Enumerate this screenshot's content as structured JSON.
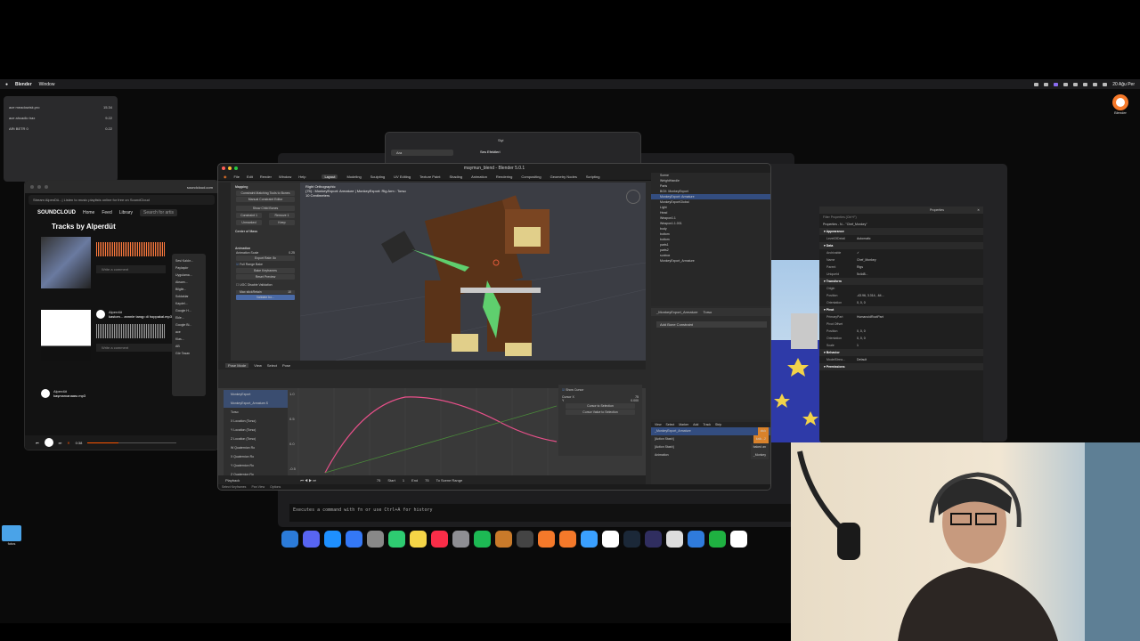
{
  "menubar": {
    "app": "Blender",
    "items": [
      "Window"
    ],
    "clock": "20 Ağu Per"
  },
  "small_panel": {
    "rows": [
      {
        "label": "ace meadowisk.pro",
        "value": "15.34"
      },
      {
        "label": "ace ahcadlo trax",
        "value": "9.22"
      },
      {
        "label": "ARt BETR 0",
        "value": "0.22"
      }
    ]
  },
  "soundcloud": {
    "domain": "soundcloud.com",
    "url": "Stream AlpenDü...| Listen to music playlists online for free on SoundCloud",
    "logo": "SOUNDCLOUD",
    "nav": [
      "Home",
      "Feed",
      "Library"
    ],
    "search_placeholder": "Search for artis",
    "page_title": "Tracks by Alperdüt",
    "tracks": [
      {
        "artist": "Alperdüt",
        "title": "kastom... annnle tanqp di hoppakal.mp3",
        "comment": "Write a comment"
      },
      {
        "artist": "Alperdüt",
        "title": "kaşmanıanaası.mp3",
        "comment": "Write a comment"
      }
    ],
    "time": "0:38",
    "context_menu": [
      "Sesi Kaldır...",
      "Paylaşılır",
      "Uygulama...",
      "Aksam...",
      "Bilgile...",
      "Soldaklar",
      "Kaydel...",
      "Google H...",
      "Ekle...",
      "Google Bi...",
      "ace",
      "Klas...",
      "AB",
      "Gör Tasarı"
    ],
    "context_progress": 0.35
  },
  "bg_window1": {
    "title": "Siyi",
    "search": "Ara",
    "item": "Ses Efektleri"
  },
  "blender": {
    "title": "maymun_blend - Blender 5.0.1",
    "menu": [
      "File",
      "Edit",
      "Render",
      "Window",
      "Help"
    ],
    "workspaces": [
      "Layout",
      "Modeling",
      "Sculpting",
      "UV Editing",
      "Texture Paint",
      "Shading",
      "Animation",
      "Rendering",
      "Compositing",
      "Geometry Nodes",
      "Scripting"
    ],
    "active_workspace": "Layout",
    "viewport_info": [
      "Right Orthographic",
      "(75) : MonkeyExport: Armature | MonkeyExport: Rig Arm : Torso",
      "10 Centimeters"
    ],
    "left_panel": {
      "section_a": "Mapping",
      "buttons": [
        "Constraint Matching Tools to Bones",
        "Manual Constraint Editor",
        "Show Child Bones",
        "Constraint 1",
        "Remove 1",
        "Unmarked",
        "Keep"
      ],
      "section_b": "Center of Mass",
      "section_c": "Animation",
      "field_scale": "Animation Scale",
      "field_scale_value": "0.25",
      "export_rate": "Export Rate: 8x",
      "checkbox_range": "Full Range Bake",
      "btn_bake": "Bake Keyframes",
      "btn_reset": "Reset Preview",
      "section_d": "UGC Disable Validation",
      "max_label": "Max stickRetain",
      "max_value": "10",
      "btn_validate": "Validate bo..."
    },
    "outliner": [
      {
        "label": "Scene",
        "sel": false
      },
      {
        "label": "WeightHandle",
        "sel": false
      },
      {
        "label": "Parts",
        "sel": false
      },
      {
        "label": "BOX: MonkeyExport",
        "sel": false
      },
      {
        "label": "MonkeyExport: Armature",
        "sel": true
      },
      {
        "label": "MonkeyExportGlobal",
        "sel": false
      },
      {
        "label": "Light",
        "sel": false
      },
      {
        "label": "Head",
        "sel": false
      },
      {
        "label": "Weapon1.1",
        "sel": false
      },
      {
        "label": "Weapon1.1.001",
        "sel": false
      },
      {
        "label": "body",
        "sel": false
      },
      {
        "label": "bottom",
        "sel": false
      },
      {
        "label": "bottom",
        "sel": false
      },
      {
        "label": "parts1",
        "sel": false
      },
      {
        "label": "parts2",
        "sel": false
      },
      {
        "label": "sunbox",
        "sel": false
      },
      {
        "label": "MonkeyExport_Armature",
        "sel": false
      }
    ],
    "properties": {
      "object": "_MonkeyExport_Armature",
      "tab": "Torso",
      "button": "Add Bone Constraint"
    },
    "graph": {
      "mode": "Pose Mode",
      "view": "View",
      "select": "Select",
      "pose": "Pose",
      "channels": [
        "MonkeyExport",
        "MonkeyExport_Armature.S",
        "Torso",
        "X Location (Torso)",
        "Y Location (Torso)",
        "Z Location (Torso)",
        "W Quaternion Ro",
        "X Quaternion Ro",
        "Y Quaternion Ro",
        "Z Quaternion Ro"
      ],
      "show_cursor": "Show Cursor",
      "cursor_x_label": "Cursor X",
      "cursor_x": "75",
      "cursor_y_label": "Y",
      "cursor_y": "0.000",
      "btn_to_selection": "Cursor to Selection",
      "btn_cursor_value": "Cursor Value to Selection",
      "y_ticks": [
        "1.0",
        "0.5",
        "0.0",
        "-0.5"
      ],
      "x_ticks": [
        "-20",
        "0",
        "20",
        "40",
        "60",
        "80",
        "100",
        "120"
      ]
    },
    "timeline": {
      "playback": "Playback",
      "frame": "75",
      "start_label": "Start",
      "start": "1",
      "end_label": "End",
      "end": "75",
      "to_scene_range": "To Scene Range"
    },
    "nla": {
      "header": [
        "View",
        "Select",
        "Marker",
        "Add",
        "Track",
        "Strip"
      ],
      "tracks": [
        "_MonkeyExport_Armature",
        "[Action Stash]",
        "[Action Stash]",
        "Animation"
      ],
      "strips": [
        "oluk",
        "kalk...2",
        "baked an",
        "_Monkey"
      ]
    },
    "status": [
      "Select Keyframes",
      "Pan View",
      "Options"
    ]
  },
  "props_window": {
    "title": "Properties",
    "filter": "Filter Properties (Ctrl+F)",
    "header": "Properties - N... \"Chef_Monkey\"",
    "sections": [
      {
        "name": "Appearance",
        "rows": [
          [
            "LevelOfDetail",
            "Automatic"
          ]
        ]
      },
      {
        "name": "Data",
        "rows": [
          [
            "Archivable",
            "✓"
          ],
          [
            "Name",
            "Chef_Monkey"
          ],
          [
            "Parent",
            "Rigs"
          ],
          [
            "UniqueId",
            "5c4d8..."
          ]
        ]
      },
      {
        "name": "Transform",
        "rows": [
          [
            "Origin",
            ""
          ],
          [
            "Position",
            "-43.96, 3.314, -64..."
          ],
          [
            "Orientation",
            "0, 0, 0"
          ]
        ]
      },
      {
        "name": "Pivot",
        "rows": [
          [
            "PrimaryPart",
            "HumanoidRootPart"
          ],
          [
            "Pivot Offset",
            ""
          ],
          [
            "Position",
            "0, 0, 0"
          ],
          [
            "Orientation",
            "0, 0, 0"
          ],
          [
            "Scale",
            "1"
          ]
        ]
      },
      {
        "name": "Behavior",
        "rows": [
          [
            "ModelStrea...",
            "Default"
          ]
        ]
      },
      {
        "name": "Permissions",
        "rows": []
      }
    ]
  },
  "terminal": {
    "text": "Executes a command with fn or use Ctrl+A for history"
  },
  "dock": {
    "icons": [
      "finder",
      "discord",
      "safari",
      "xcode",
      "launchpad",
      "maps",
      "notes",
      "music",
      "settings",
      "spotify",
      "tool",
      "activity",
      "blender",
      "blender",
      "ql",
      "arc",
      "steam",
      "obs",
      "app",
      "roblox-studio",
      "numbers",
      "chrome"
    ]
  },
  "desktop": {
    "folder_label": "fotos",
    "blender_label": "Blender"
  },
  "colors": {
    "soundcloud_accent": "#ff5500",
    "blender_selection": "#334d80",
    "curve": "#e8508a"
  }
}
